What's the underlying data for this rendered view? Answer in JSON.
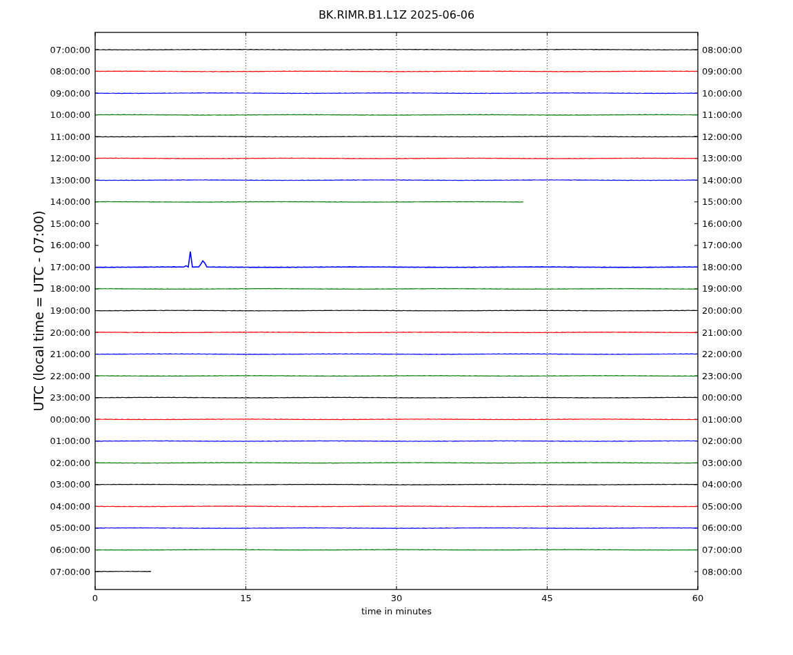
{
  "title": "BK.RIMR.B1.L1Z 2025-06-06",
  "ylabel": "UTC (local time = UTC - 07:00)",
  "xlabel": "time in minutes",
  "xticks": [
    "0",
    "15",
    "30",
    "45",
    "60"
  ],
  "rows": [
    {
      "left": "07:00:00",
      "right": "08:00:00",
      "color": "#000000",
      "level": 1,
      "kind": "quiet"
    },
    {
      "left": "08:00:00",
      "right": "09:00:00",
      "color": "#ff0000",
      "level": 1,
      "kind": "quiet"
    },
    {
      "left": "09:00:00",
      "right": "10:00:00",
      "color": "#0000ff",
      "level": 1,
      "kind": "quiet"
    },
    {
      "left": "10:00:00",
      "right": "11:00:00",
      "color": "#008000",
      "level": 1,
      "kind": "quiet"
    },
    {
      "left": "11:00:00",
      "right": "12:00:00",
      "color": "#000000",
      "level": 1,
      "kind": "quiet"
    },
    {
      "left": "12:00:00",
      "right": "13:00:00",
      "color": "#ff0000",
      "level": 1,
      "kind": "quiet"
    },
    {
      "left": "13:00:00",
      "right": "14:00:00",
      "color": "#0000ff",
      "level": 1,
      "kind": "quiet"
    },
    {
      "left": "14:00:00",
      "right": "15:00:00",
      "color": "#008000",
      "level": 0.713,
      "kind": "quiet"
    },
    {
      "left": "15:00:00",
      "right": "16:00:00",
      "kind": "quiet"
    },
    {
      "left": "16:00:00",
      "right": "17:00:00",
      "kind": "quiet"
    },
    {
      "left": "17:00:00",
      "right": "18:00:00",
      "color": "#0000ff",
      "level": 1,
      "kind": "event"
    },
    {
      "left": "18:00:00",
      "right": "19:00:00",
      "color": "#008000",
      "level": 1,
      "kind": "quiet"
    },
    {
      "left": "19:00:00",
      "right": "20:00:00",
      "color": "#000000",
      "level": 1,
      "kind": "quiet"
    },
    {
      "left": "20:00:00",
      "right": "21:00:00",
      "color": "#ff0000",
      "level": 1,
      "kind": "quiet"
    },
    {
      "left": "21:00:00",
      "right": "22:00:00",
      "color": "#0000ff",
      "level": 1,
      "kind": "quiet"
    },
    {
      "left": "22:00:00",
      "right": "23:00:00",
      "color": "#008000",
      "level": 1,
      "kind": "quiet"
    },
    {
      "left": "23:00:00",
      "right": "00:00:00",
      "color": "#000000",
      "level": 1,
      "kind": "quiet"
    },
    {
      "left": "00:00:00",
      "right": "01:00:00",
      "color": "#ff0000",
      "level": 1,
      "kind": "quiet"
    },
    {
      "left": "01:00:00",
      "right": "02:00:00",
      "color": "#0000ff",
      "level": 1,
      "kind": "quiet"
    },
    {
      "left": "02:00:00",
      "right": "03:00:00",
      "color": "#008000",
      "level": 1,
      "kind": "quiet"
    },
    {
      "left": "03:00:00",
      "right": "04:00:00",
      "color": "#000000",
      "level": 1,
      "kind": "quiet"
    },
    {
      "left": "04:00:00",
      "right": "05:00:00",
      "color": "#ff0000",
      "level": 1,
      "kind": "quiet"
    },
    {
      "left": "05:00:00",
      "right": "06:00:00",
      "color": "#0000ff",
      "level": 1,
      "kind": "quiet"
    },
    {
      "left": "06:00:00",
      "right": "07:00:00",
      "color": "#008000",
      "level": 1,
      "kind": "quiet"
    },
    {
      "left": "07:00:00",
      "right": "08:00:00",
      "color": "#000000",
      "level": 0.095,
      "kind": "quiet"
    }
  ]
}
